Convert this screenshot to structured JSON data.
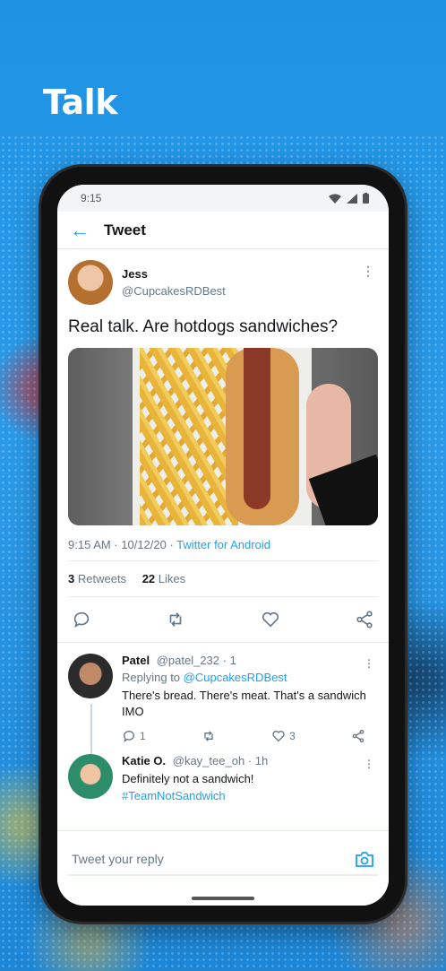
{
  "headline": "Talk",
  "status": {
    "time": "9:15"
  },
  "topbar": {
    "title": "Tweet"
  },
  "tweet": {
    "author_name": "Jess",
    "author_handle": "@CupcakesRDBest",
    "text": "Real talk. Are hotdogs sandwiches?",
    "timestamp": "9:15 AM · 10/12/20 · ",
    "via": "Twitter for Android",
    "retweets_count": "3",
    "retweets_label": "Retweets",
    "likes_count": "22",
    "likes_label": "Likes"
  },
  "replies": [
    {
      "name": "Patel",
      "handle": "@patel_232",
      "time": "· 1",
      "replying_prefix": "Replying to ",
      "replying_to": "@CupcakesRDBest",
      "text": "There's bread. There's meat. That's a sandwich IMO",
      "reply_count": "1",
      "like_count": "3"
    },
    {
      "name": "Katie O.",
      "handle": "@kay_tee_oh",
      "time": "· 1h",
      "text": "Definitely not a sandwich!",
      "hashtag": "#TeamNotSandwich"
    }
  ],
  "composer": {
    "placeholder": "Tweet your reply"
  },
  "colors": {
    "accent": "#1da1f2",
    "background": "#1d8fe0",
    "text": "#14171a",
    "muted": "#657786"
  },
  "icons": [
    "back-arrow-icon",
    "wifi-icon",
    "signal-icon",
    "battery-icon",
    "more-icon",
    "reply-icon",
    "retweet-icon",
    "like-icon",
    "share-icon",
    "camera-icon"
  ]
}
